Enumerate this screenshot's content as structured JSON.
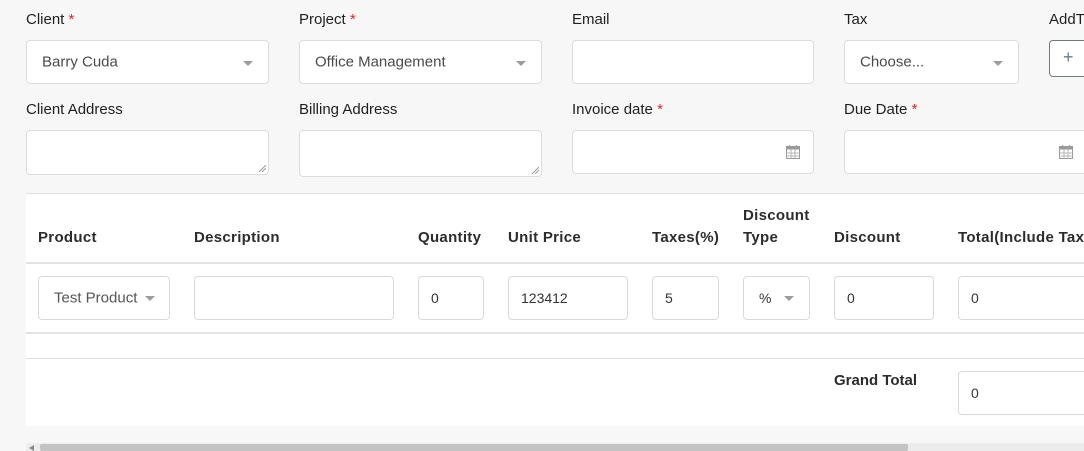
{
  "form": {
    "client": {
      "label": "Client",
      "required_mark": "*",
      "value": "Barry Cuda"
    },
    "project": {
      "label": "Project",
      "required_mark": "*",
      "value": "Office Management"
    },
    "email": {
      "label": "Email",
      "value": ""
    },
    "tax": {
      "label": "Tax",
      "value": "Choose..."
    },
    "add_tax": {
      "label": "AddT",
      "icon": "plus-icon",
      "glyph": "+"
    },
    "client_address": {
      "label": "Client Address",
      "value": ""
    },
    "billing_address": {
      "label": "Billing Address",
      "value": ""
    },
    "invoice_date": {
      "label": "Invoice date",
      "required_mark": "*",
      "value": "",
      "icon": "calendar-icon"
    },
    "due_date": {
      "label": "Due Date",
      "required_mark": "*",
      "value": "",
      "icon": "calendar-icon"
    }
  },
  "items_table": {
    "headers": {
      "product": "Product",
      "description": "Description",
      "quantity": "Quantity",
      "unit_price": "Unit Price",
      "taxes": "Taxes(%)",
      "discount_type_line1": "Discount",
      "discount_type_line2": "Type",
      "discount": "Discount",
      "total": "Total(Include Tax"
    },
    "rows": [
      {
        "product": "Test Product",
        "description": "",
        "quantity": "0",
        "unit_price": "123412",
        "taxes": "5",
        "discount_type": "%",
        "discount": "0",
        "total": "0"
      }
    ],
    "grand_total": {
      "label": "Grand Total",
      "value": "0"
    }
  },
  "colors": {
    "required": "#e5252a",
    "border": "#dcdcdc",
    "page_bg": "#f7f7f7"
  }
}
